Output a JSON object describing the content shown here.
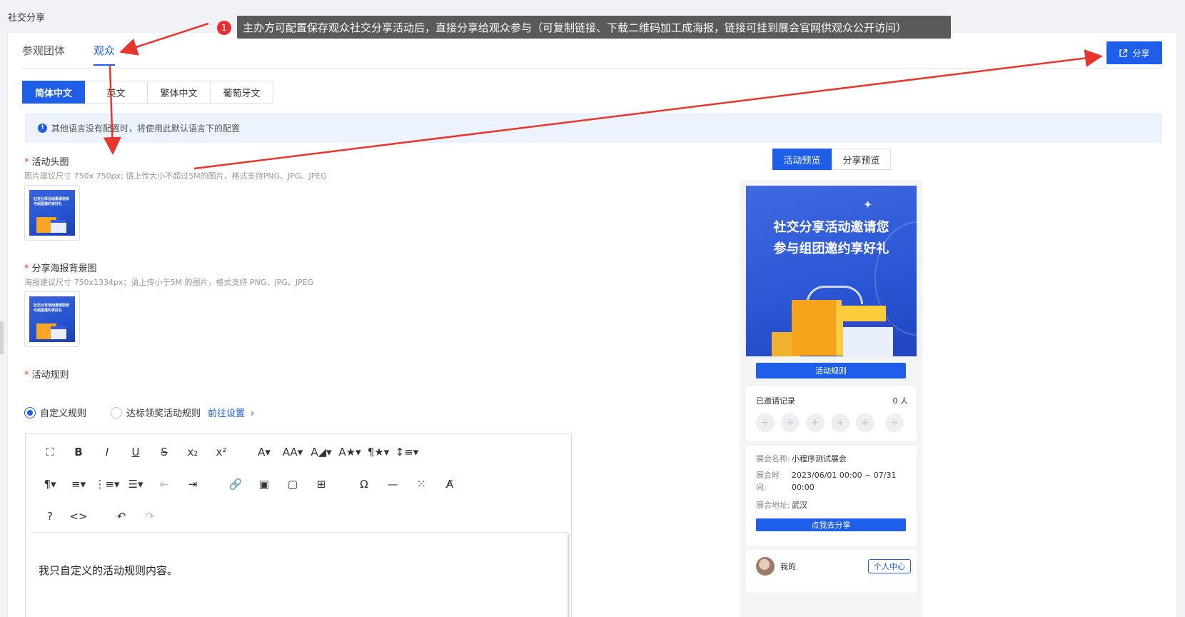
{
  "page": {
    "title": "社交分享"
  },
  "tabs": [
    {
      "label": "参观团体",
      "active": false
    },
    {
      "label": "观众",
      "active": true
    }
  ],
  "share_button": {
    "label": "分享",
    "icon": "external-link-icon"
  },
  "languages": [
    {
      "label": "简体中文",
      "active": true
    },
    {
      "label": "英文",
      "active": false
    },
    {
      "label": "繁体中文",
      "active": false
    },
    {
      "label": "葡萄牙文",
      "active": false
    }
  ],
  "info_bar": {
    "text": "其他语言没有配置时，将使用此默认语言下的配置",
    "icon": "info-icon"
  },
  "fields": {
    "header_image": {
      "label": "活动头图",
      "hint": "图片建议尺寸 750x 750px; 请上传大小不超过5M的图片，格式支持PNG、JPG、JPEG"
    },
    "poster_bg": {
      "label": "分享海报背景图",
      "hint": "海报建议尺寸 750x1334px；请上传小于5M 的图片，格式支持 PNG、JPG、JPEG"
    },
    "rules": {
      "label": "活动规则"
    }
  },
  "thumb_text": "社交分享活动邀请您参与组团邀约享好礼",
  "rules_options": {
    "custom": {
      "label": "自定义规则",
      "checked": true
    },
    "award": {
      "label": "达标领奖活动规则",
      "checked": false
    },
    "link": "前往设置"
  },
  "editor": {
    "content": "我只自定义的活动规则内容。",
    "toolbar_row1": [
      "⛶",
      "B",
      "I",
      "U",
      "S",
      "x₂",
      "x²",
      "A▾",
      "AA▾",
      "A◢▾",
      "A★▾",
      "¶★▾",
      "↕≡▾"
    ],
    "toolbar_row2": [
      "¶▾",
      "≡▾",
      "⋮≡▾",
      "☰▾",
      "⇤",
      "⇥",
      "🔗",
      "▣",
      "▢",
      "⊞",
      "Ω",
      "—",
      "⁙",
      "A̸"
    ],
    "toolbar_row3": [
      "?",
      "<>",
      "↶",
      "↷"
    ]
  },
  "preview": {
    "tabs": [
      {
        "label": "活动预览",
        "active": true
      },
      {
        "label": "分享预览",
        "active": false
      }
    ],
    "poster_title_line1": "社交分享活动邀请您",
    "poster_title_line2": "参与组团邀约享好礼",
    "rules_button": "活动规则",
    "invited": {
      "label": "已邀请记录",
      "count": "0 人",
      "slots": [
        "+",
        "+",
        "+",
        "+",
        "+",
        "+"
      ]
    },
    "expo_name_label": "展会名称:",
    "expo_name": "小程序测试展会",
    "expo_time_label1": "展会时",
    "expo_time_label2": "间:",
    "expo_time_line1": "2023/06/01 00:00 ~ 07/31",
    "expo_time_line2": "00:00",
    "expo_addr_label": "展会地址:",
    "expo_addr": "武汉",
    "share_button": "点我去分享",
    "me_label": "我的",
    "personal_center": "个人中心"
  },
  "annotation": {
    "number": "1",
    "text": "主办方可配置保存观众社交分享活动后，直接分享给观众参与（可复制链接、下载二维码加工成海报，链接可挂到展会官网供观众公开访问）",
    "arrow_color": "#e8362f"
  },
  "colors": {
    "primary": "#1e5ee8",
    "required": "#e8402e",
    "info_bg": "#edf3fd"
  }
}
